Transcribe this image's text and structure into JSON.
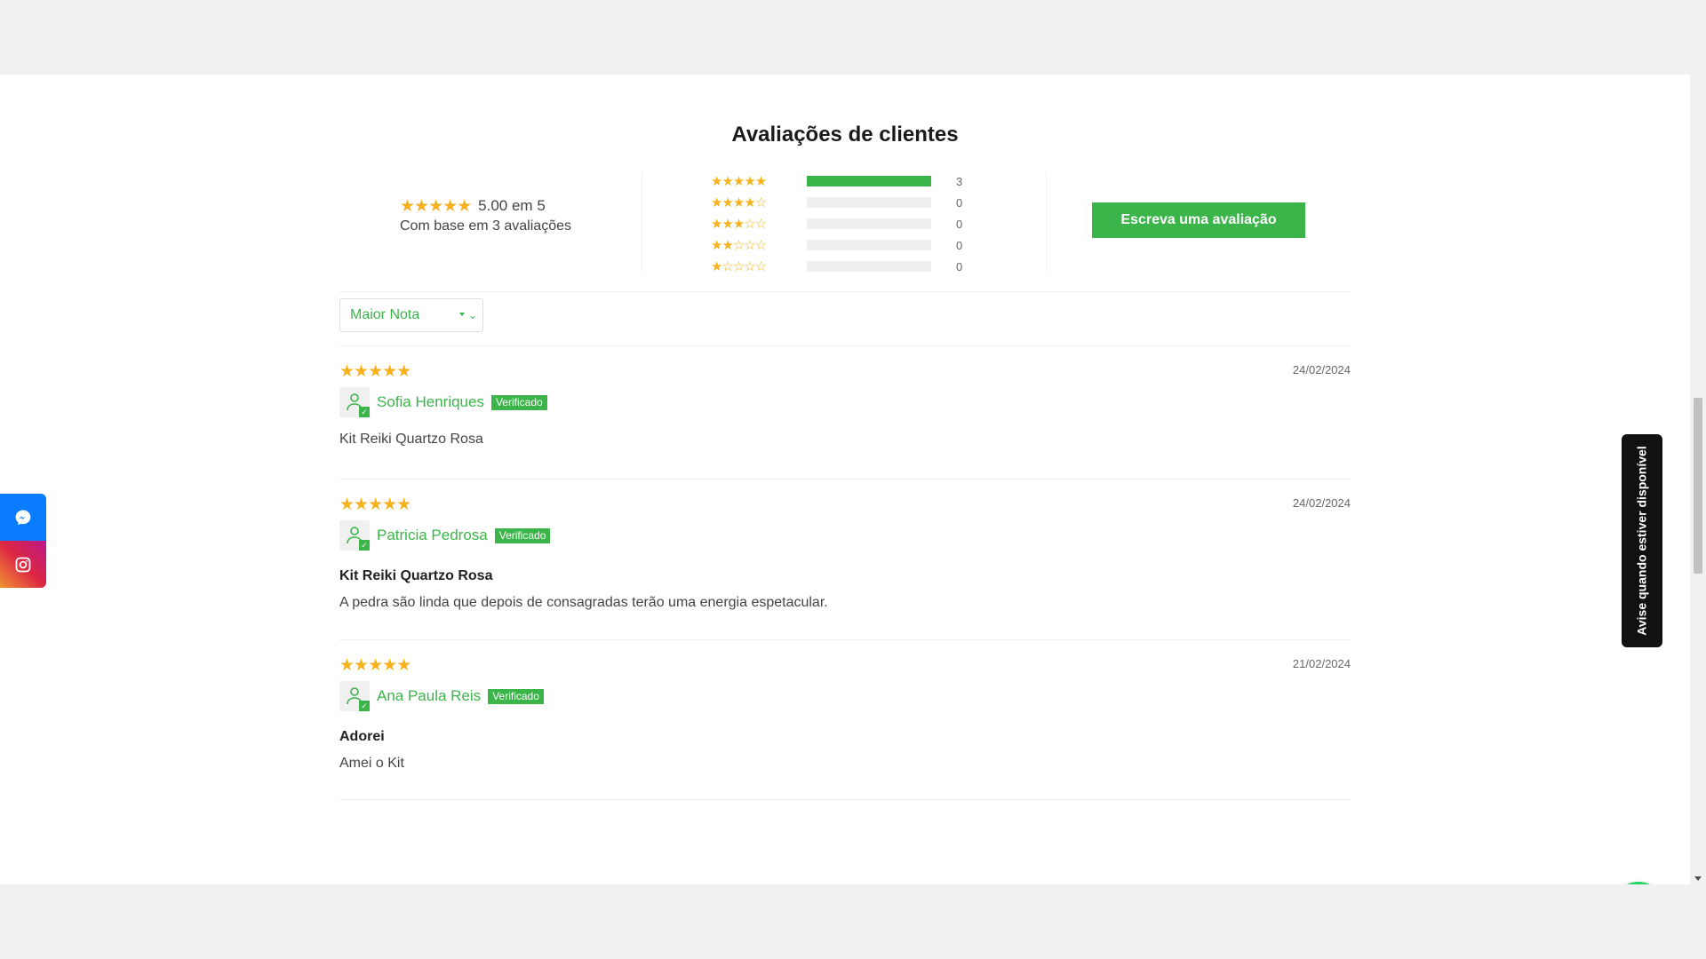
{
  "section_title": "Avaliações de clientes",
  "summary": {
    "stars": "★★★★★",
    "average_text": "5.00 em 5",
    "based_on_text": "Com base em 3 avaliações",
    "rating_value": 5.0,
    "histogram": [
      {
        "stars": "★★★★★",
        "count": "3",
        "fraction": 1.0
      },
      {
        "stars": "★★★★☆",
        "count": "0",
        "fraction": 0.0
      },
      {
        "stars": "★★★☆☆",
        "count": "0",
        "fraction": 0.0
      },
      {
        "stars": "★★☆☆☆",
        "count": "0",
        "fraction": 0.0
      },
      {
        "stars": "★☆☆☆☆",
        "count": "0",
        "fraction": 0.0
      }
    ],
    "write_button": "Escreva uma avaliação"
  },
  "sort": {
    "selected": "Maior Nota"
  },
  "reviews": [
    {
      "stars": "★★★★★",
      "date": "24/02/2024",
      "author": "Sofia Henriques",
      "badge": "Verificado",
      "title": "",
      "body": "Kit Reiki Quartzo Rosa"
    },
    {
      "stars": "★★★★★",
      "date": "24/02/2024",
      "author": "Patricia Pedrosa",
      "badge": "Verificado",
      "title": "Kit Reiki Quartzo Rosa",
      "body": "A pedra são linda que depois de consagradas terão uma energia espetacular."
    },
    {
      "stars": "★★★★★",
      "date": "21/02/2024",
      "author": "Ana Paula Reis",
      "badge": "Verificado",
      "title": "Adorei",
      "body": "Amei o Kit"
    }
  ],
  "notify_tab": "Avise quando estiver disponível",
  "icons": {
    "messenger": "messenger-icon",
    "instagram": "instagram-icon",
    "whatsapp": "whatsapp-icon",
    "avatar": "user-icon",
    "check": "check-icon",
    "dropdown": "chevron-down-icon"
  },
  "colors": {
    "accent_green": "#3bb54a",
    "star_gold": "#f6b21b",
    "messenger_blue": "#0a7cff",
    "whatsapp_green": "#25d366"
  }
}
